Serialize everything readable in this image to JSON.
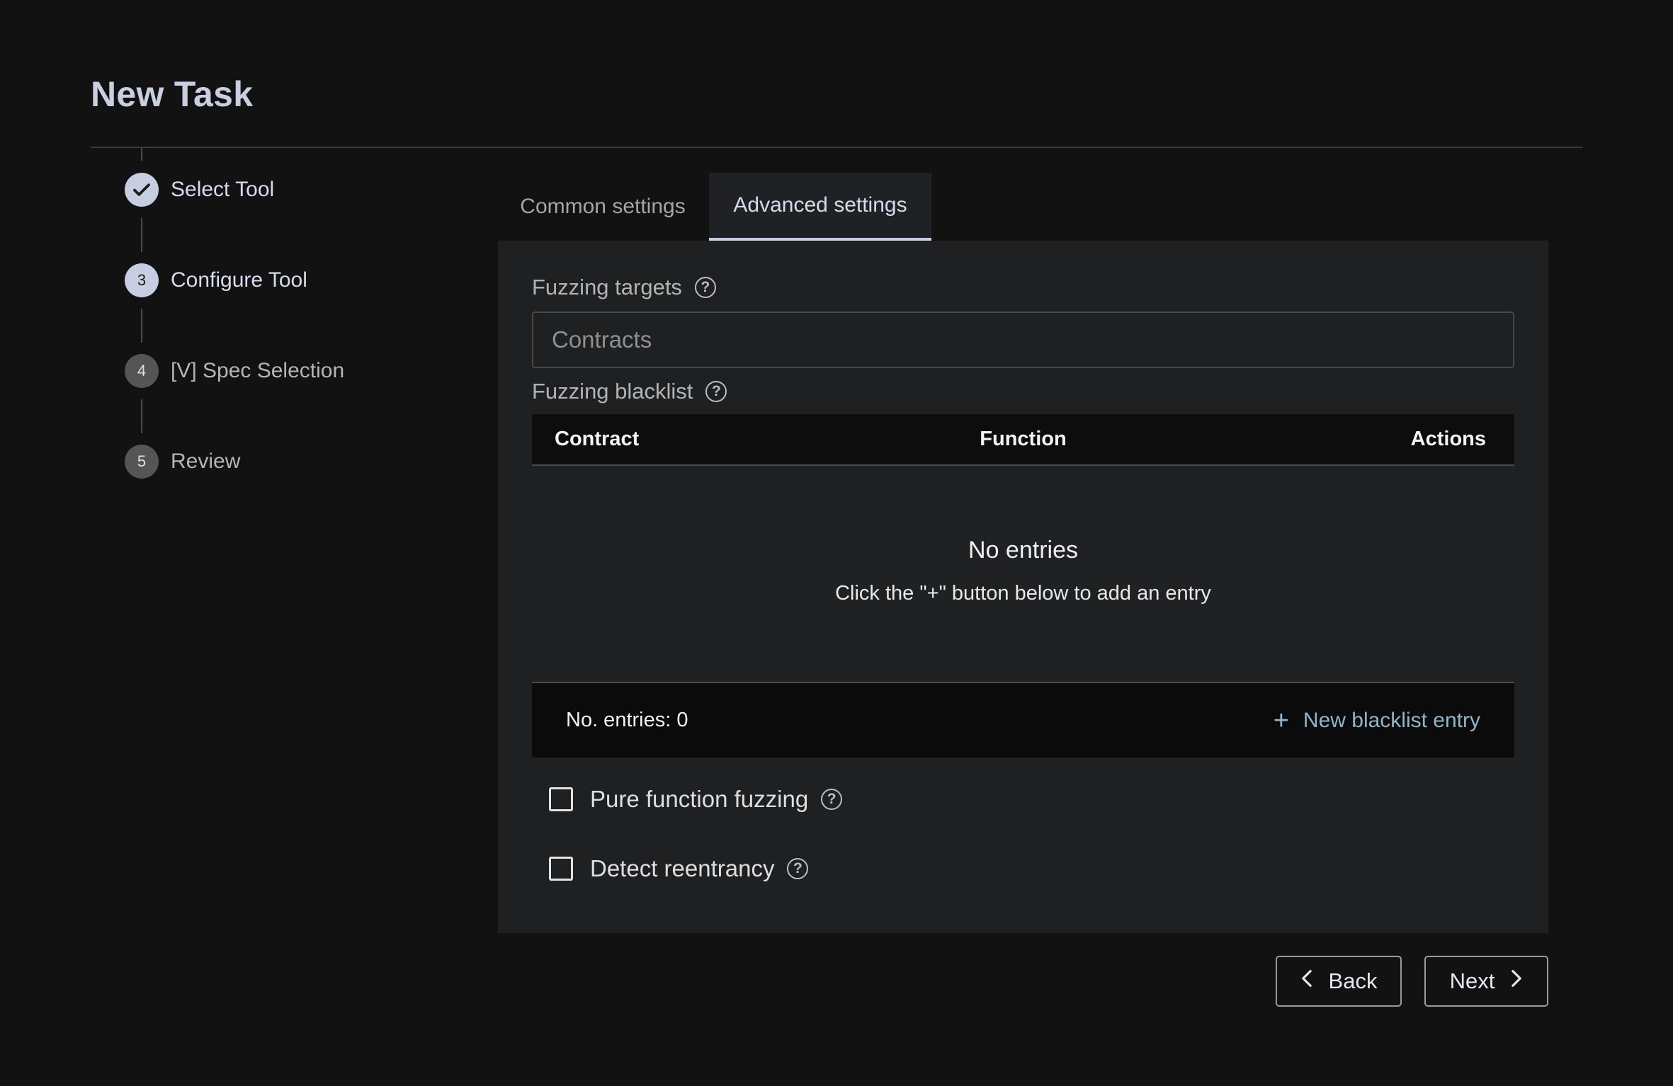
{
  "page": {
    "title": "New Task"
  },
  "stepper": {
    "steps": [
      {
        "label": "Select Tool",
        "status": "completed",
        "number": ""
      },
      {
        "label": "Configure Tool",
        "status": "active",
        "number": "3"
      },
      {
        "label": "[V] Spec Selection",
        "status": "pending",
        "number": "4"
      },
      {
        "label": "Review",
        "status": "pending",
        "number": "5"
      }
    ]
  },
  "tabs": [
    {
      "label": "Common settings",
      "selected": false
    },
    {
      "label": "Advanced settings",
      "selected": true
    }
  ],
  "advanced": {
    "fuzzing_targets": {
      "label": "Fuzzing targets",
      "placeholder": "Contracts",
      "value": ""
    },
    "fuzzing_blacklist": {
      "label": "Fuzzing blacklist",
      "columns": [
        "Contract",
        "Function",
        "Actions"
      ],
      "rows": [],
      "empty_title": "No entries",
      "empty_hint": "Click the \"+\" button below to add an entry",
      "entries_count": "No. entries: 0",
      "add_label": "New blacklist entry"
    },
    "pure_function_fuzzing": {
      "label": "Pure function fuzzing",
      "checked": false
    },
    "detect_reentrancy": {
      "label": "Detect reentrancy",
      "checked": false
    }
  },
  "nav": {
    "back_label": "Back",
    "next_label": "Next"
  },
  "icons": {
    "help": "question-circle-icon",
    "check": "check-icon",
    "plus": "plus-icon",
    "chevron_left": "chevron-left-icon",
    "chevron_right": "chevron-right-icon"
  },
  "colors": {
    "background": "#121212",
    "panel": "#1f2022",
    "accent": "#c8cee2",
    "link": "#8fb6c8"
  }
}
